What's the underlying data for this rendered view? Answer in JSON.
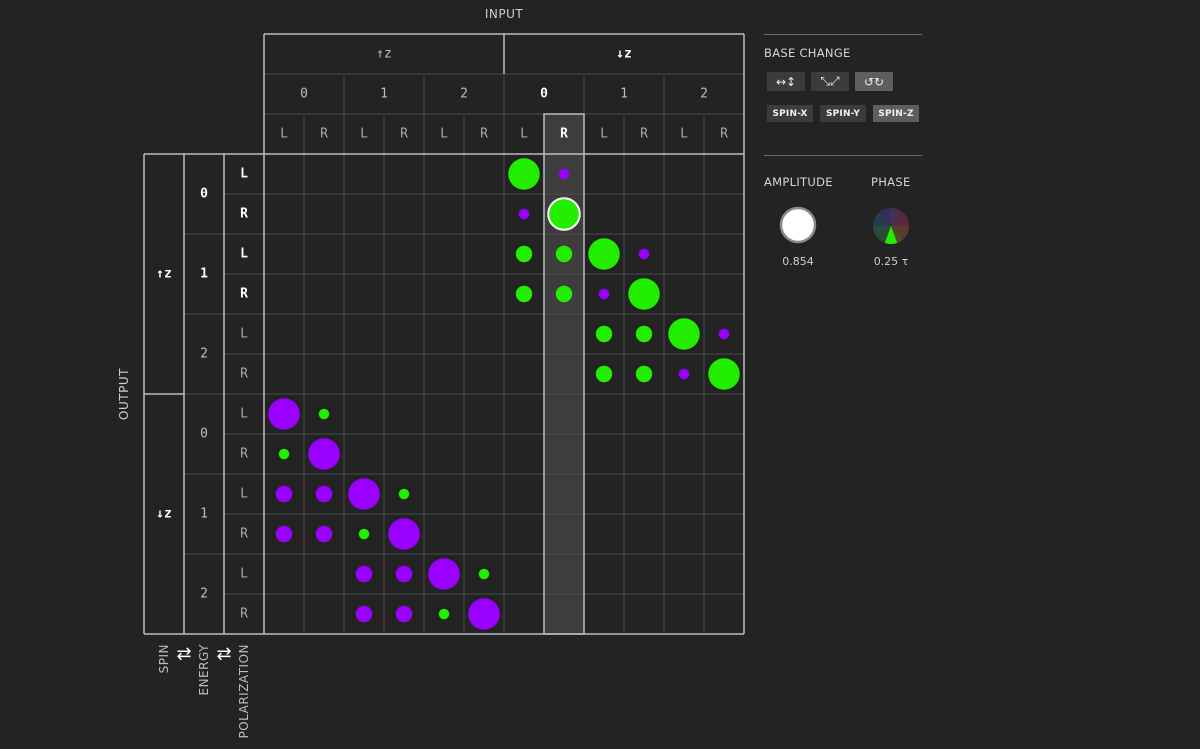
{
  "input_label": "INPUT",
  "output_label": "OUTPUT",
  "spin_up": "↑z",
  "spin_down": "↓z",
  "energies": [
    "0",
    "1",
    "2"
  ],
  "polarizations": [
    "L",
    "R"
  ],
  "ordering": {
    "spin": "SPIN",
    "energy": "ENERGY",
    "polarization": "POLARIZATION",
    "swap_glyph": "⇄"
  },
  "selected_input": {
    "spin": "↓z",
    "energy": "0",
    "polarization": "R"
  },
  "colors": {
    "green": "#22ee00",
    "purple": "#9a00ff",
    "grid": "#4a4a4a",
    "highlight": "#3d3d3d"
  },
  "panel": {
    "base_change_title": "BASE CHANGE",
    "basis_icons": [
      {
        "name": "horizontal-vertical-icon",
        "glyph": "↔↕",
        "active": false
      },
      {
        "name": "diagonal-icon",
        "glyph": "⤡⤢",
        "active": false
      },
      {
        "name": "circular-icon",
        "glyph": "↺↻",
        "active": true
      }
    ],
    "spin_buttons": [
      {
        "label": "SPIN-X",
        "active": false
      },
      {
        "label": "SPIN-Y",
        "active": false
      },
      {
        "label": "SPIN-Z",
        "active": true
      }
    ],
    "amplitude_label": "AMPLITUDE",
    "phase_label": "PHASE",
    "amplitude_value": "0.854",
    "phase_value": "0.25 τ"
  },
  "matrix": {
    "note": "rows: output index 0-11 (↑z E0 L,R, E1 L,R, E2 L,R, ↓z E0 L,R, E1 L,R, E2 L,R); cols: input index 0-11 same order; size: relative amplitude",
    "entries": [
      {
        "row": 0,
        "col": 6,
        "color": "green",
        "size": 0.85
      },
      {
        "row": 0,
        "col": 7,
        "color": "purple",
        "size": 0.15
      },
      {
        "row": 1,
        "col": 6,
        "color": "purple",
        "size": 0.15
      },
      {
        "row": 1,
        "col": 7,
        "color": "green",
        "size": 0.85,
        "selected": true
      },
      {
        "row": 2,
        "col": 6,
        "color": "green",
        "size": 0.35
      },
      {
        "row": 2,
        "col": 7,
        "color": "green",
        "size": 0.35
      },
      {
        "row": 2,
        "col": 8,
        "color": "green",
        "size": 0.85
      },
      {
        "row": 2,
        "col": 9,
        "color": "purple",
        "size": 0.15
      },
      {
        "row": 3,
        "col": 6,
        "color": "green",
        "size": 0.35
      },
      {
        "row": 3,
        "col": 7,
        "color": "green",
        "size": 0.35
      },
      {
        "row": 3,
        "col": 8,
        "color": "purple",
        "size": 0.15
      },
      {
        "row": 3,
        "col": 9,
        "color": "green",
        "size": 0.85
      },
      {
        "row": 4,
        "col": 8,
        "color": "green",
        "size": 0.35
      },
      {
        "row": 4,
        "col": 9,
        "color": "green",
        "size": 0.35
      },
      {
        "row": 4,
        "col": 10,
        "color": "green",
        "size": 0.85
      },
      {
        "row": 4,
        "col": 11,
        "color": "purple",
        "size": 0.15
      },
      {
        "row": 5,
        "col": 8,
        "color": "green",
        "size": 0.35
      },
      {
        "row": 5,
        "col": 9,
        "color": "green",
        "size": 0.35
      },
      {
        "row": 5,
        "col": 10,
        "color": "purple",
        "size": 0.15
      },
      {
        "row": 5,
        "col": 11,
        "color": "green",
        "size": 0.85
      },
      {
        "row": 6,
        "col": 0,
        "color": "purple",
        "size": 0.85
      },
      {
        "row": 6,
        "col": 1,
        "color": "green",
        "size": 0.15
      },
      {
        "row": 7,
        "col": 0,
        "color": "green",
        "size": 0.15
      },
      {
        "row": 7,
        "col": 1,
        "color": "purple",
        "size": 0.85
      },
      {
        "row": 8,
        "col": 0,
        "color": "purple",
        "size": 0.35
      },
      {
        "row": 8,
        "col": 1,
        "color": "purple",
        "size": 0.35
      },
      {
        "row": 8,
        "col": 2,
        "color": "purple",
        "size": 0.85
      },
      {
        "row": 8,
        "col": 3,
        "color": "green",
        "size": 0.15
      },
      {
        "row": 9,
        "col": 0,
        "color": "purple",
        "size": 0.35
      },
      {
        "row": 9,
        "col": 1,
        "color": "purple",
        "size": 0.35
      },
      {
        "row": 9,
        "col": 2,
        "color": "green",
        "size": 0.15
      },
      {
        "row": 9,
        "col": 3,
        "color": "purple",
        "size": 0.85
      },
      {
        "row": 10,
        "col": 2,
        "color": "purple",
        "size": 0.35
      },
      {
        "row": 10,
        "col": 3,
        "color": "purple",
        "size": 0.35
      },
      {
        "row": 10,
        "col": 4,
        "color": "purple",
        "size": 0.85
      },
      {
        "row": 10,
        "col": 5,
        "color": "green",
        "size": 0.15
      },
      {
        "row": 11,
        "col": 2,
        "color": "purple",
        "size": 0.35
      },
      {
        "row": 11,
        "col": 3,
        "color": "purple",
        "size": 0.35
      },
      {
        "row": 11,
        "col": 4,
        "color": "green",
        "size": 0.15
      },
      {
        "row": 11,
        "col": 5,
        "color": "purple",
        "size": 0.85
      }
    ]
  }
}
